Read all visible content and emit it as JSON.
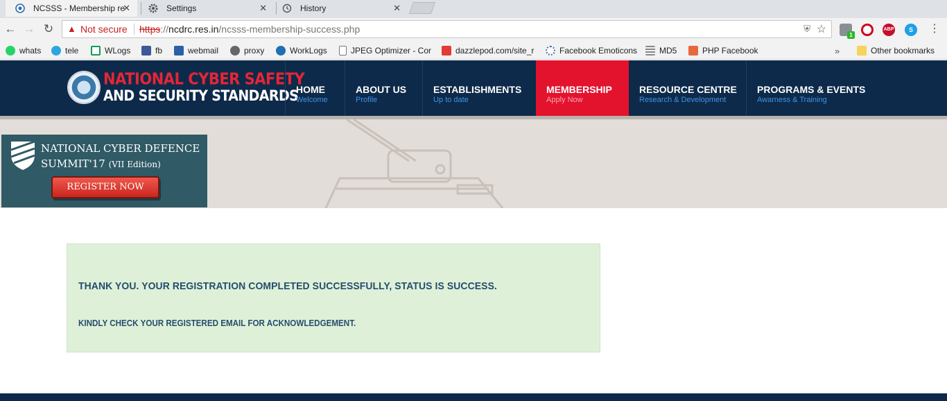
{
  "browser": {
    "tabs": [
      {
        "title": "NCSSS - Membership re",
        "icon": "globe-icon",
        "close": "✕"
      },
      {
        "title": "Settings",
        "icon": "gear-icon",
        "close": "✕"
      },
      {
        "title": "History",
        "icon": "history-icon",
        "close": "✕"
      }
    ],
    "address_bar": {
      "security_label": "Not secure",
      "url_protocol": "https",
      "url_separator": "://",
      "url_host": "ncdrc.res.in",
      "url_path": "/ncsss-membership-success.php"
    },
    "extensions": [
      {
        "name": "extension-badge-icon",
        "badge": "1",
        "color": "#8a8f96"
      },
      {
        "name": "opera-icon",
        "color": "#d0021b"
      },
      {
        "name": "abp-icon",
        "label": "ABP",
        "color": "#c70d2c"
      },
      {
        "name": "skype-icon",
        "label": "S",
        "color": "#1ea0e6"
      }
    ],
    "bookmarks": [
      {
        "label": "whats",
        "icon": "whatsapp-icon",
        "color": "#25d366"
      },
      {
        "label": "tele",
        "icon": "telegram-icon",
        "color": "#2ca5e0"
      },
      {
        "label": "WLogs",
        "icon": "sheets-icon",
        "color": "#0f9d58"
      },
      {
        "label": "fb",
        "icon": "facebook-icon",
        "color": "#3b5998"
      },
      {
        "label": "webmail",
        "icon": "webmail-icon",
        "color": "#2d5fa8"
      },
      {
        "label": "proxy",
        "icon": "gear-icon",
        "color": "#666666"
      },
      {
        "label": "WorkLogs",
        "icon": "worklogs-icon",
        "color": "#1f6fb5"
      },
      {
        "label": "JPEG Optimizer - Cor",
        "icon": "page-icon",
        "color": "#ffffff"
      },
      {
        "label": "dazzlepod.com/site_r",
        "icon": "dazzlepod-icon",
        "color": "#e53935"
      },
      {
        "label": "Facebook Emoticons",
        "icon": "flower-icon",
        "color": "#4a6fa5"
      },
      {
        "label": "MD5",
        "icon": "binary-icon",
        "color": "#888888"
      },
      {
        "label": "PHP Facebook",
        "icon": "plus-icon",
        "color": "#e8683e"
      }
    ],
    "bookmarks_overflow": "»",
    "other_bookmarks": "Other bookmarks"
  },
  "site": {
    "logo_line1": "NATIONAL CYBER SAFETY",
    "logo_line2": "AND SECURITY STANDARDS",
    "nav": [
      {
        "label": "HOME",
        "sub": "Welcome"
      },
      {
        "label": "ABOUT US",
        "sub": "Profile"
      },
      {
        "label": "ESTABLISHMENTS",
        "sub": "Up to date"
      },
      {
        "label": "MEMBERSHIP",
        "sub": "Apply Now",
        "active": true
      },
      {
        "label": "RESOURCE CENTRE",
        "sub": "Research & Development"
      },
      {
        "label": "PROGRAMS & EVENTS",
        "sub": "Awarness & Training"
      }
    ],
    "colors": {
      "header_bg": "#0e2a4a",
      "active_nav": "#e3132e",
      "nav_sub": "#3d95e6",
      "logo_red": "#e32636"
    }
  },
  "banner": {
    "summit_title_line1": "NATIONAL CYBER DEFENCE",
    "summit_title_line2": "SUMMIT'17",
    "summit_edition": "(VII Edition)",
    "register_button": "REGISTER NOW"
  },
  "message": {
    "title": "THANK YOU. YOUR REGISTRATION COMPLETED SUCCESSFULLY, STATUS IS SUCCESS.",
    "note": "KINDLY CHECK YOUR REGISTERED EMAIL FOR ACKNOWLEDGEMENT.",
    "box_color": "#dff0d8"
  }
}
